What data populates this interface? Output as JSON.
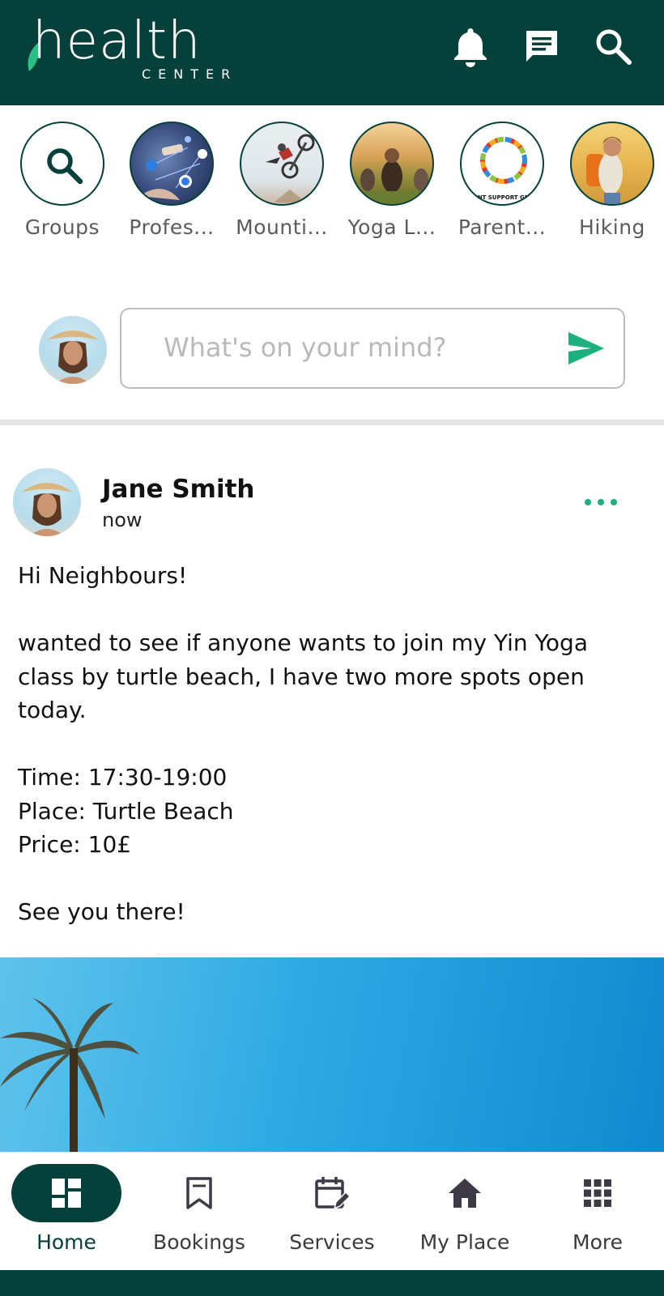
{
  "header": {
    "logo_word": "health",
    "logo_sub": "CENTER",
    "icons": [
      "bell-icon",
      "chat-icon",
      "search-icon"
    ]
  },
  "groups": [
    {
      "label": "Groups",
      "kind": "search"
    },
    {
      "label": "Profes...",
      "kind": "network-photo"
    },
    {
      "label": "Mounti...",
      "kind": "bike-photo"
    },
    {
      "label": "Yoga L...",
      "kind": "yoga-photo"
    },
    {
      "label": "Parent...",
      "kind": "parent-logo",
      "logo_text": "ENT SUPPORT GRO"
    },
    {
      "label": "Hiking",
      "kind": "hiking-photo"
    }
  ],
  "composer": {
    "placeholder": "What's on your mind?"
  },
  "post": {
    "author": "Jane Smith",
    "time": "now",
    "body": "Hi Neighbours!\n\nwanted to see if anyone wants to join my Yin Yoga class by turtle beach, I have two more spots open today.\n\nTime: 17:30-19:00\nPlace: Turtle Beach\nPrice: 10£\n\nSee you there!"
  },
  "nav": [
    {
      "label": "Home",
      "icon": "dashboard-icon",
      "active": true
    },
    {
      "label": "Bookings",
      "icon": "bookmark-icon",
      "active": false
    },
    {
      "label": "Services",
      "icon": "calendar-edit-icon",
      "active": false
    },
    {
      "label": "My Place",
      "icon": "house-icon",
      "active": false
    },
    {
      "label": "More",
      "icon": "grid-icon",
      "active": false
    }
  ],
  "colors": {
    "brand": "#06403a",
    "accent": "#1db07e"
  }
}
